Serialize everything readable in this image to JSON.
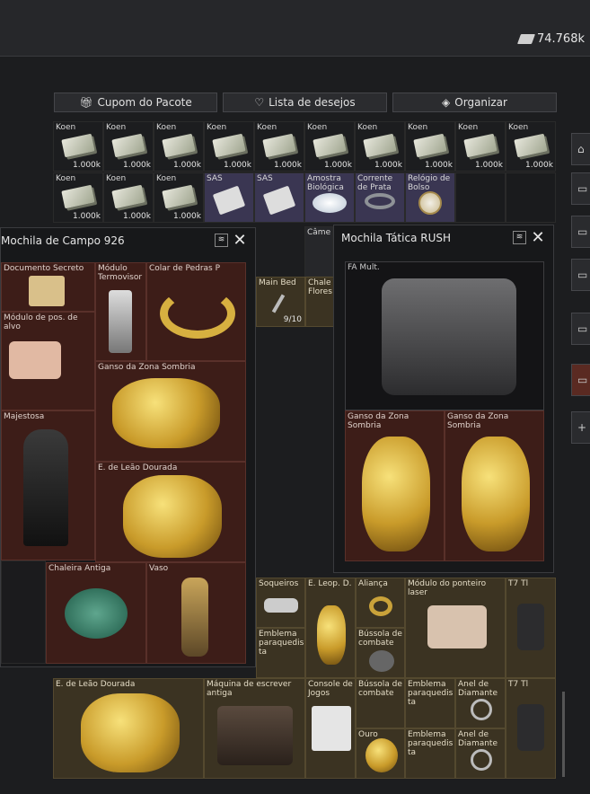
{
  "currency": {
    "amount": "74.768k",
    "icon": "banknote-icon"
  },
  "toolbar": {
    "coupon": {
      "label": "Cupom do Pacote",
      "icon": "gift-icon"
    },
    "wishlist": {
      "label": "Lista de desejos",
      "icon": "heart-icon"
    },
    "organize": {
      "label": "Organizar",
      "icon": "layers-icon"
    }
  },
  "stash": {
    "row1": [
      {
        "label": "Koen",
        "count": "1.000k"
      },
      {
        "label": "Koen",
        "count": "1.000k"
      },
      {
        "label": "Koen",
        "count": "1.000k"
      },
      {
        "label": "Koen",
        "count": "1.000k"
      },
      {
        "label": "Koen",
        "count": "1.000k"
      },
      {
        "label": "Koen",
        "count": "1.000k"
      },
      {
        "label": "Koen",
        "count": "1.000k"
      },
      {
        "label": "Koen",
        "count": "1.000k"
      },
      {
        "label": "Koen",
        "count": "1.000k"
      },
      {
        "label": "Koen",
        "count": "1.000k"
      }
    ],
    "row2": [
      {
        "label": "Koen",
        "count": "1.000k"
      },
      {
        "label": "Koen",
        "count": "1.000k"
      },
      {
        "label": "Koen",
        "count": "1.000k"
      },
      {
        "label": "SAS",
        "count": ""
      },
      {
        "label": "SAS",
        "count": ""
      },
      {
        "label": "Amostra Biológica",
        "count": ""
      },
      {
        "label": "Corrente de Prata",
        "count": ""
      },
      {
        "label": "Relógio de Bolso",
        "count": ""
      }
    ],
    "partial": {
      "camera": "Câme",
      "main_bed": "Main Bed",
      "main_bed_count": "9/10",
      "chaleira": "Chale Flores"
    }
  },
  "backpack_left": {
    "title": "Mochila de Campo 926",
    "items": {
      "doc": "Documento Secreto",
      "modulo": "Módulo Termovisor",
      "colar": "Colar de Pedras P",
      "alvo": "Módulo de pos. de alvo",
      "ganso": "Ganso da Zona Sombria",
      "majestosa": "Majestosa",
      "leao": "E. de Leão Dourada",
      "chaleira": "Chaleira Antiga",
      "vaso": "Vaso"
    }
  },
  "backpack_right": {
    "title": "Mochila Tática RUSH",
    "fa": "FA Mult.",
    "ganso1": "Ganso da Zona Sombria",
    "ganso2": "Ganso da Zona Sombria"
  },
  "lower": {
    "soqueiros": "Soqueiros",
    "leop": "E. Leop. D.",
    "alianca": "Aliança",
    "ponteiro": "Módulo do ponteiro laser",
    "t7a": "T7 Tl",
    "emblema1": "Emblema paraquedis ta",
    "bussola1": "Bússola de combate",
    "leao": "E. de Leão Dourada",
    "maquina": "Máquina de escrever antiga",
    "console": "Console de Jogos",
    "bussola2": "Bússola de combate",
    "emblema2": "Emblema paraquedis ta",
    "anel1": "Anel de Diamante",
    "t7b": "T7 Tl",
    "ouro": "Ouro",
    "emblema3": "Emblema paraquedis ta",
    "anel2": "Anel de Diamante"
  }
}
